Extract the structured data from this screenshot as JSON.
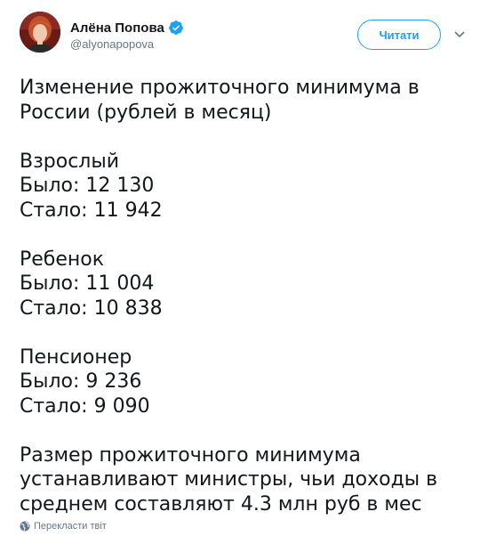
{
  "author": {
    "display_name": "Алёна Попова",
    "username": "@alyonapopova",
    "verified": true,
    "avatar_icon": "user-avatar-photo"
  },
  "follow_button": {
    "label": "Читати"
  },
  "menu": {
    "caret_icon": "chevron-down-icon"
  },
  "tweet": {
    "lines": [
      "Изменение прожиточного минимума в",
      "России (рублей в месяц)",
      "",
      "Взрослый",
      "Было: 12 130",
      "Стало: 11 942",
      "",
      "Ребенок",
      "Было: 11 004",
      "Стало: 10 838",
      "",
      "Пенсионер",
      "Было: 9 236",
      "Стало: 9 090",
      "",
      "Размер прожиточного минимума",
      "устанавливают министры, чьи доходы в",
      "среднем составляют 4.3 млн руб в мес"
    ]
  },
  "translate": {
    "label": "Перекласти твіт",
    "icon": "globe-icon"
  },
  "colors": {
    "accent": "#1da1f2",
    "text": "#14171a",
    "secondary": "#657786"
  }
}
